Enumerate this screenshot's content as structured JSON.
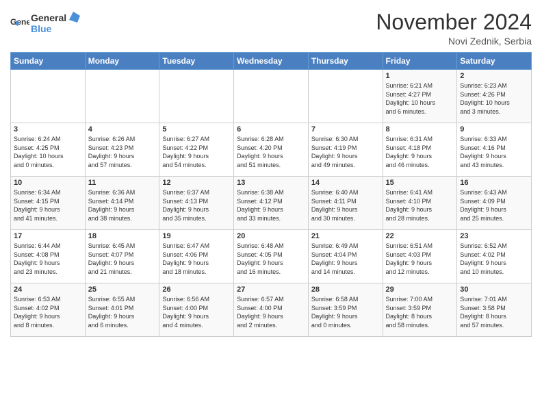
{
  "header": {
    "logo_general": "General",
    "logo_blue": "Blue",
    "month_title": "November 2024",
    "location": "Novi Zednik, Serbia"
  },
  "weekdays": [
    "Sunday",
    "Monday",
    "Tuesday",
    "Wednesday",
    "Thursday",
    "Friday",
    "Saturday"
  ],
  "weeks": [
    [
      {
        "day": "",
        "info": ""
      },
      {
        "day": "",
        "info": ""
      },
      {
        "day": "",
        "info": ""
      },
      {
        "day": "",
        "info": ""
      },
      {
        "day": "",
        "info": ""
      },
      {
        "day": "1",
        "info": "Sunrise: 6:21 AM\nSunset: 4:27 PM\nDaylight: 10 hours\nand 6 minutes."
      },
      {
        "day": "2",
        "info": "Sunrise: 6:23 AM\nSunset: 4:26 PM\nDaylight: 10 hours\nand 3 minutes."
      }
    ],
    [
      {
        "day": "3",
        "info": "Sunrise: 6:24 AM\nSunset: 4:25 PM\nDaylight: 10 hours\nand 0 minutes."
      },
      {
        "day": "4",
        "info": "Sunrise: 6:26 AM\nSunset: 4:23 PM\nDaylight: 9 hours\nand 57 minutes."
      },
      {
        "day": "5",
        "info": "Sunrise: 6:27 AM\nSunset: 4:22 PM\nDaylight: 9 hours\nand 54 minutes."
      },
      {
        "day": "6",
        "info": "Sunrise: 6:28 AM\nSunset: 4:20 PM\nDaylight: 9 hours\nand 51 minutes."
      },
      {
        "day": "7",
        "info": "Sunrise: 6:30 AM\nSunset: 4:19 PM\nDaylight: 9 hours\nand 49 minutes."
      },
      {
        "day": "8",
        "info": "Sunrise: 6:31 AM\nSunset: 4:18 PM\nDaylight: 9 hours\nand 46 minutes."
      },
      {
        "day": "9",
        "info": "Sunrise: 6:33 AM\nSunset: 4:16 PM\nDaylight: 9 hours\nand 43 minutes."
      }
    ],
    [
      {
        "day": "10",
        "info": "Sunrise: 6:34 AM\nSunset: 4:15 PM\nDaylight: 9 hours\nand 41 minutes."
      },
      {
        "day": "11",
        "info": "Sunrise: 6:36 AM\nSunset: 4:14 PM\nDaylight: 9 hours\nand 38 minutes."
      },
      {
        "day": "12",
        "info": "Sunrise: 6:37 AM\nSunset: 4:13 PM\nDaylight: 9 hours\nand 35 minutes."
      },
      {
        "day": "13",
        "info": "Sunrise: 6:38 AM\nSunset: 4:12 PM\nDaylight: 9 hours\nand 33 minutes."
      },
      {
        "day": "14",
        "info": "Sunrise: 6:40 AM\nSunset: 4:11 PM\nDaylight: 9 hours\nand 30 minutes."
      },
      {
        "day": "15",
        "info": "Sunrise: 6:41 AM\nSunset: 4:10 PM\nDaylight: 9 hours\nand 28 minutes."
      },
      {
        "day": "16",
        "info": "Sunrise: 6:43 AM\nSunset: 4:09 PM\nDaylight: 9 hours\nand 25 minutes."
      }
    ],
    [
      {
        "day": "17",
        "info": "Sunrise: 6:44 AM\nSunset: 4:08 PM\nDaylight: 9 hours\nand 23 minutes."
      },
      {
        "day": "18",
        "info": "Sunrise: 6:45 AM\nSunset: 4:07 PM\nDaylight: 9 hours\nand 21 minutes."
      },
      {
        "day": "19",
        "info": "Sunrise: 6:47 AM\nSunset: 4:06 PM\nDaylight: 9 hours\nand 18 minutes."
      },
      {
        "day": "20",
        "info": "Sunrise: 6:48 AM\nSunset: 4:05 PM\nDaylight: 9 hours\nand 16 minutes."
      },
      {
        "day": "21",
        "info": "Sunrise: 6:49 AM\nSunset: 4:04 PM\nDaylight: 9 hours\nand 14 minutes."
      },
      {
        "day": "22",
        "info": "Sunrise: 6:51 AM\nSunset: 4:03 PM\nDaylight: 9 hours\nand 12 minutes."
      },
      {
        "day": "23",
        "info": "Sunrise: 6:52 AM\nSunset: 4:02 PM\nDaylight: 9 hours\nand 10 minutes."
      }
    ],
    [
      {
        "day": "24",
        "info": "Sunrise: 6:53 AM\nSunset: 4:02 PM\nDaylight: 9 hours\nand 8 minutes."
      },
      {
        "day": "25",
        "info": "Sunrise: 6:55 AM\nSunset: 4:01 PM\nDaylight: 9 hours\nand 6 minutes."
      },
      {
        "day": "26",
        "info": "Sunrise: 6:56 AM\nSunset: 4:00 PM\nDaylight: 9 hours\nand 4 minutes."
      },
      {
        "day": "27",
        "info": "Sunrise: 6:57 AM\nSunset: 4:00 PM\nDaylight: 9 hours\nand 2 minutes."
      },
      {
        "day": "28",
        "info": "Sunrise: 6:58 AM\nSunset: 3:59 PM\nDaylight: 9 hours\nand 0 minutes."
      },
      {
        "day": "29",
        "info": "Sunrise: 7:00 AM\nSunset: 3:59 PM\nDaylight: 8 hours\nand 58 minutes."
      },
      {
        "day": "30",
        "info": "Sunrise: 7:01 AM\nSunset: 3:58 PM\nDaylight: 8 hours\nand 57 minutes."
      }
    ]
  ]
}
